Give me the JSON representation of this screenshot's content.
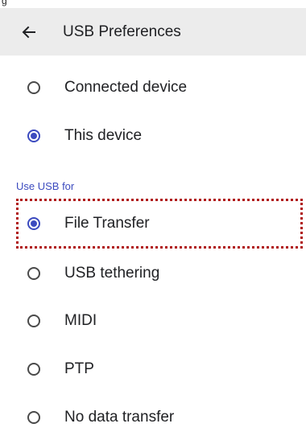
{
  "status_bar": {
    "partial_glyph": "g"
  },
  "header": {
    "back_icon": "arrow-back-icon",
    "title": "USB Preferences"
  },
  "mode_options": [
    {
      "label": "Connected device",
      "selected": false
    },
    {
      "label": "This device",
      "selected": true
    }
  ],
  "use_usb_section": {
    "header": "Use USB for",
    "options": [
      {
        "label": "File Transfer",
        "selected": true,
        "highlighted": true
      },
      {
        "label": "USB tethering",
        "selected": false
      },
      {
        "label": "MIDI",
        "selected": false
      },
      {
        "label": "PTP",
        "selected": false
      },
      {
        "label": "No data transfer",
        "selected": false
      }
    ]
  },
  "colors": {
    "accent": "#3c4bbf",
    "app_bar_bg": "#ececec",
    "highlight_border": "#b01818"
  }
}
